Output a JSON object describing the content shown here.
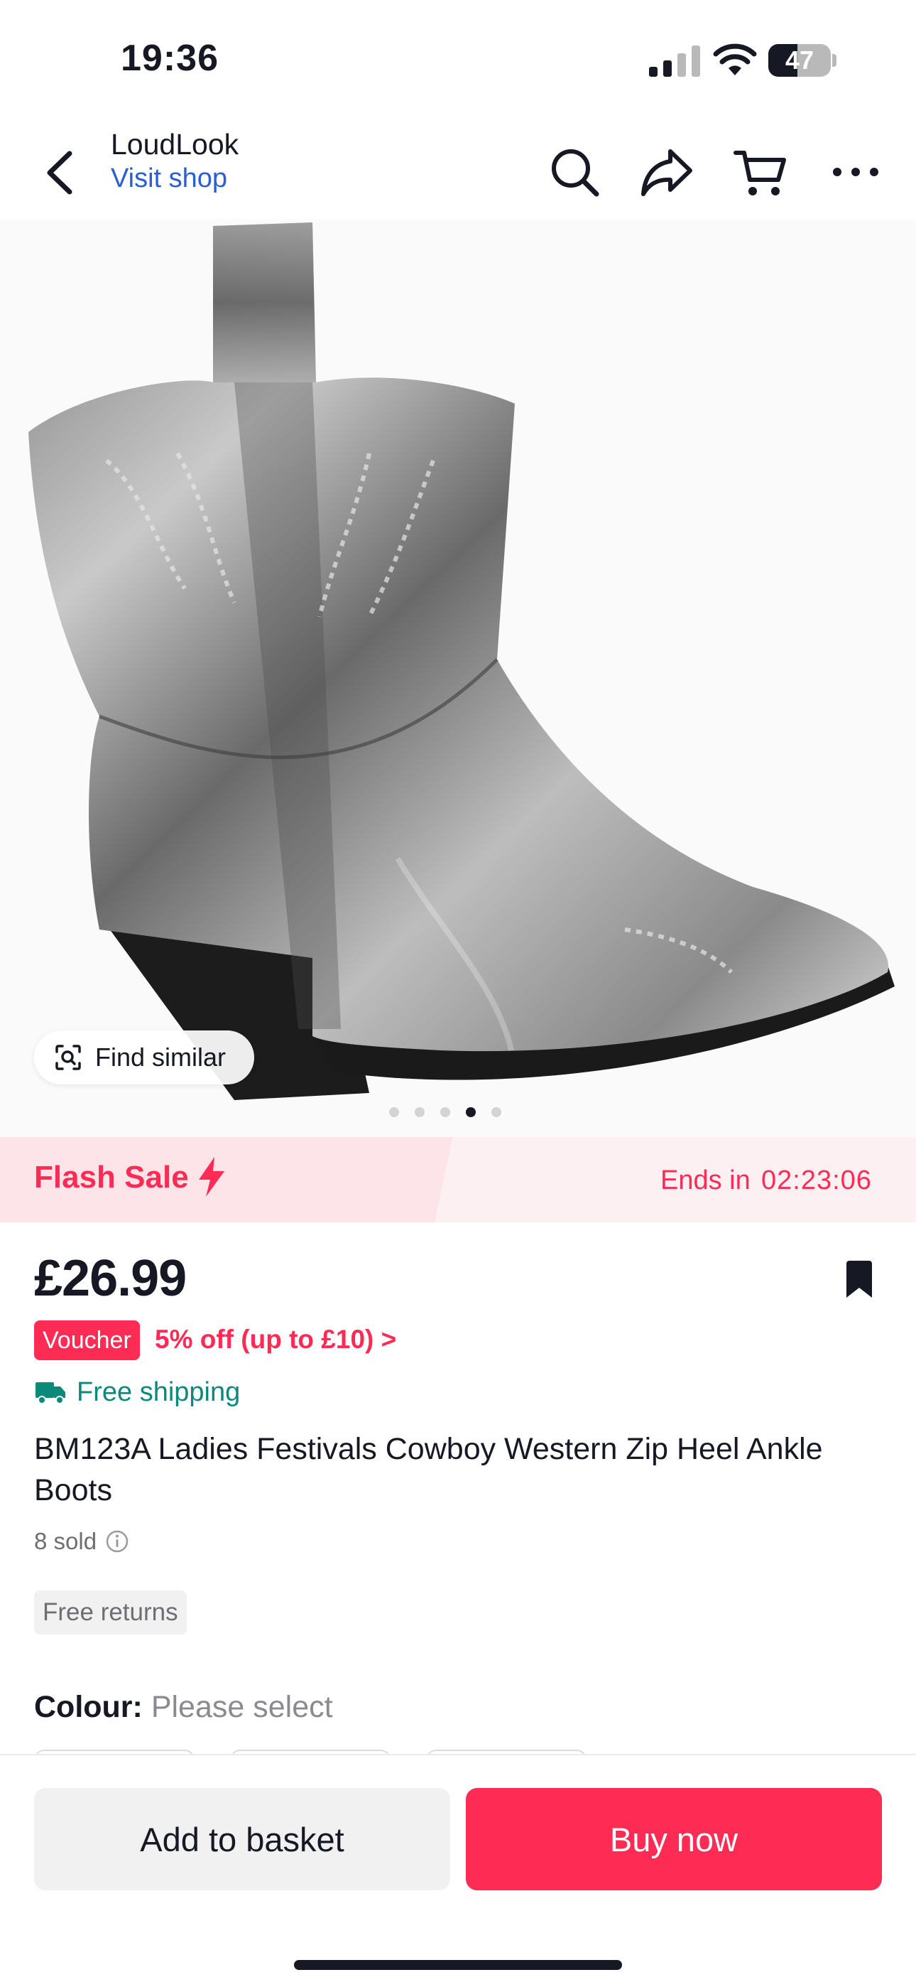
{
  "status_bar": {
    "time": "19:36",
    "battery_level": "47",
    "battery_fraction": 0.47
  },
  "header": {
    "shop_name": "LoudLook",
    "visit_shop": "Visit shop",
    "icons": [
      "back-icon",
      "search-icon",
      "share-icon",
      "cart-icon",
      "more-icon"
    ]
  },
  "gallery": {
    "find_similar": "Find similar",
    "dots": 5,
    "active_index": 3
  },
  "flash_sale": {
    "title": "Flash Sale",
    "ends_label": "Ends in",
    "countdown": "02:23:06"
  },
  "product": {
    "price": "£26.99",
    "voucher_badge": "Voucher",
    "voucher_text": "5% off (up to £10) >",
    "shipping": "Free shipping",
    "title": "BM123A Ladies Festivals Cowboy Western Zip Heel Ankle Boots",
    "sold": "8 sold",
    "returns_tag": "Free returns",
    "colour_label": "Colour:",
    "colour_value": "Please select"
  },
  "actions": {
    "add_to_basket": "Add to basket",
    "buy_now": "Buy now"
  },
  "colors": {
    "accent": "#fe2c55",
    "link": "#2a5fd4",
    "shipping": "#0b8a7a",
    "flash_bg": "#fde4e8"
  }
}
